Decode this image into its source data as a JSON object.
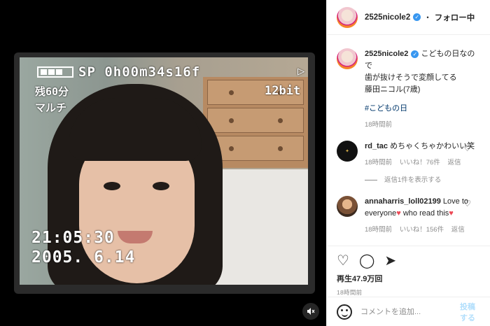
{
  "video": {
    "osd": {
      "mode": "SP 0h00m34s16f",
      "remaining": "残60分",
      "mode2": "マルチ",
      "bits": "12bit",
      "play": "▷",
      "time": "21:05:30",
      "date": "2005. 6.14"
    },
    "mute_icon": "mute-icon"
  },
  "header": {
    "username": "2525nicole2",
    "separator": "・",
    "follow": "フォロー中"
  },
  "caption": {
    "username": "2525nicole2",
    "line1": "こどもの日なので",
    "line2": "歯が抜けそうで変顔してる",
    "line3": "藤田ニコル(7歳)",
    "hashtag": "#こどもの日",
    "time": "18時間前"
  },
  "comments": [
    {
      "username": "rd_tac",
      "text": "めちゃくちゃかわいい笑",
      "time": "18時間前",
      "likes": "いいね！76件",
      "reply": "返信",
      "view_replies": "返信1件を表示する"
    },
    {
      "username": "annaharris_loll02199",
      "text_a": "Love to everyone",
      "text_b": " who read this",
      "time": "18時間前",
      "likes": "いいね！156件",
      "reply": "返信"
    }
  ],
  "actions": {
    "views": "再生47.9万回",
    "time": "18時間前"
  },
  "add_comment": {
    "placeholder": "コメントを追加...",
    "post": "投稿する"
  },
  "colors": {
    "accent": "#3897f0",
    "heart": "#ed4956",
    "link": "#00376b"
  }
}
